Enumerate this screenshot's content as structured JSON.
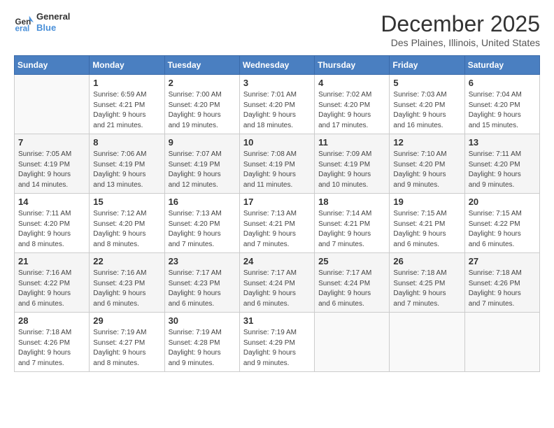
{
  "logo": {
    "line1": "General",
    "line2": "Blue"
  },
  "title": "December 2025",
  "subtitle": "Des Plaines, Illinois, United States",
  "days_of_week": [
    "Sunday",
    "Monday",
    "Tuesday",
    "Wednesday",
    "Thursday",
    "Friday",
    "Saturday"
  ],
  "weeks": [
    [
      {
        "day": "",
        "info": ""
      },
      {
        "day": "1",
        "info": "Sunrise: 6:59 AM\nSunset: 4:21 PM\nDaylight: 9 hours\nand 21 minutes."
      },
      {
        "day": "2",
        "info": "Sunrise: 7:00 AM\nSunset: 4:20 PM\nDaylight: 9 hours\nand 19 minutes."
      },
      {
        "day": "3",
        "info": "Sunrise: 7:01 AM\nSunset: 4:20 PM\nDaylight: 9 hours\nand 18 minutes."
      },
      {
        "day": "4",
        "info": "Sunrise: 7:02 AM\nSunset: 4:20 PM\nDaylight: 9 hours\nand 17 minutes."
      },
      {
        "day": "5",
        "info": "Sunrise: 7:03 AM\nSunset: 4:20 PM\nDaylight: 9 hours\nand 16 minutes."
      },
      {
        "day": "6",
        "info": "Sunrise: 7:04 AM\nSunset: 4:20 PM\nDaylight: 9 hours\nand 15 minutes."
      }
    ],
    [
      {
        "day": "7",
        "info": "Sunrise: 7:05 AM\nSunset: 4:19 PM\nDaylight: 9 hours\nand 14 minutes."
      },
      {
        "day": "8",
        "info": "Sunrise: 7:06 AM\nSunset: 4:19 PM\nDaylight: 9 hours\nand 13 minutes."
      },
      {
        "day": "9",
        "info": "Sunrise: 7:07 AM\nSunset: 4:19 PM\nDaylight: 9 hours\nand 12 minutes."
      },
      {
        "day": "10",
        "info": "Sunrise: 7:08 AM\nSunset: 4:19 PM\nDaylight: 9 hours\nand 11 minutes."
      },
      {
        "day": "11",
        "info": "Sunrise: 7:09 AM\nSunset: 4:19 PM\nDaylight: 9 hours\nand 10 minutes."
      },
      {
        "day": "12",
        "info": "Sunrise: 7:10 AM\nSunset: 4:20 PM\nDaylight: 9 hours\nand 9 minutes."
      },
      {
        "day": "13",
        "info": "Sunrise: 7:11 AM\nSunset: 4:20 PM\nDaylight: 9 hours\nand 9 minutes."
      }
    ],
    [
      {
        "day": "14",
        "info": "Sunrise: 7:11 AM\nSunset: 4:20 PM\nDaylight: 9 hours\nand 8 minutes."
      },
      {
        "day": "15",
        "info": "Sunrise: 7:12 AM\nSunset: 4:20 PM\nDaylight: 9 hours\nand 8 minutes."
      },
      {
        "day": "16",
        "info": "Sunrise: 7:13 AM\nSunset: 4:20 PM\nDaylight: 9 hours\nand 7 minutes."
      },
      {
        "day": "17",
        "info": "Sunrise: 7:13 AM\nSunset: 4:21 PM\nDaylight: 9 hours\nand 7 minutes."
      },
      {
        "day": "18",
        "info": "Sunrise: 7:14 AM\nSunset: 4:21 PM\nDaylight: 9 hours\nand 7 minutes."
      },
      {
        "day": "19",
        "info": "Sunrise: 7:15 AM\nSunset: 4:21 PM\nDaylight: 9 hours\nand 6 minutes."
      },
      {
        "day": "20",
        "info": "Sunrise: 7:15 AM\nSunset: 4:22 PM\nDaylight: 9 hours\nand 6 minutes."
      }
    ],
    [
      {
        "day": "21",
        "info": "Sunrise: 7:16 AM\nSunset: 4:22 PM\nDaylight: 9 hours\nand 6 minutes."
      },
      {
        "day": "22",
        "info": "Sunrise: 7:16 AM\nSunset: 4:23 PM\nDaylight: 9 hours\nand 6 minutes."
      },
      {
        "day": "23",
        "info": "Sunrise: 7:17 AM\nSunset: 4:23 PM\nDaylight: 9 hours\nand 6 minutes."
      },
      {
        "day": "24",
        "info": "Sunrise: 7:17 AM\nSunset: 4:24 PM\nDaylight: 9 hours\nand 6 minutes."
      },
      {
        "day": "25",
        "info": "Sunrise: 7:17 AM\nSunset: 4:24 PM\nDaylight: 9 hours\nand 6 minutes."
      },
      {
        "day": "26",
        "info": "Sunrise: 7:18 AM\nSunset: 4:25 PM\nDaylight: 9 hours\nand 7 minutes."
      },
      {
        "day": "27",
        "info": "Sunrise: 7:18 AM\nSunset: 4:26 PM\nDaylight: 9 hours\nand 7 minutes."
      }
    ],
    [
      {
        "day": "28",
        "info": "Sunrise: 7:18 AM\nSunset: 4:26 PM\nDaylight: 9 hours\nand 7 minutes."
      },
      {
        "day": "29",
        "info": "Sunrise: 7:19 AM\nSunset: 4:27 PM\nDaylight: 9 hours\nand 8 minutes."
      },
      {
        "day": "30",
        "info": "Sunrise: 7:19 AM\nSunset: 4:28 PM\nDaylight: 9 hours\nand 9 minutes."
      },
      {
        "day": "31",
        "info": "Sunrise: 7:19 AM\nSunset: 4:29 PM\nDaylight: 9 hours\nand 9 minutes."
      },
      {
        "day": "",
        "info": ""
      },
      {
        "day": "",
        "info": ""
      },
      {
        "day": "",
        "info": ""
      }
    ]
  ]
}
